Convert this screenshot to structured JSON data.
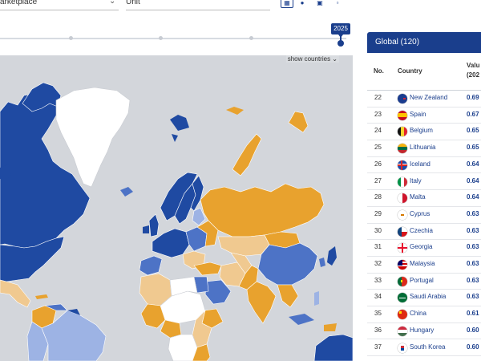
{
  "filters": {
    "marketplace_label": "arketplace",
    "unit_label": "Unit"
  },
  "timeline": {
    "selected_year": "2025"
  },
  "map": {
    "toggle_label": "show countries",
    "colors": {
      "ocean": "#d3d6db",
      "land_nodata": "#ffffff",
      "dark_blue": "#1f4aa2",
      "mid_blue": "#4d73c6",
      "light_blue": "#9db3e4",
      "orange": "#e8a22e",
      "light_orange": "#f0c990"
    }
  },
  "table": {
    "header": "Global (120)",
    "columns": {
      "no": "No.",
      "country": "Country",
      "value": "Valu",
      "value_sub": "(202"
    },
    "rows": [
      {
        "no": "22",
        "country": "New Zealand",
        "value": "0.69",
        "flag": "nz"
      },
      {
        "no": "23",
        "country": "Spain",
        "value": "0.67",
        "flag": "es"
      },
      {
        "no": "24",
        "country": "Belgium",
        "value": "0.65",
        "flag": "be"
      },
      {
        "no": "25",
        "country": "Lithuania",
        "value": "0.65",
        "flag": "lt"
      },
      {
        "no": "26",
        "country": "Iceland",
        "value": "0.64",
        "flag": "is"
      },
      {
        "no": "27",
        "country": "Italy",
        "value": "0.64",
        "flag": "it"
      },
      {
        "no": "28",
        "country": "Malta",
        "value": "0.64",
        "flag": "mt"
      },
      {
        "no": "29",
        "country": "Cyprus",
        "value": "0.63",
        "flag": "cy"
      },
      {
        "no": "30",
        "country": "Czechia",
        "value": "0.63",
        "flag": "cz"
      },
      {
        "no": "31",
        "country": "Georgia",
        "value": "0.63",
        "flag": "ge"
      },
      {
        "no": "32",
        "country": "Malaysia",
        "value": "0.63",
        "flag": "my"
      },
      {
        "no": "33",
        "country": "Portugal",
        "value": "0.63",
        "flag": "pt"
      },
      {
        "no": "34",
        "country": "Saudi Arabia",
        "value": "0.63",
        "flag": "sa"
      },
      {
        "no": "35",
        "country": "China",
        "value": "0.61",
        "flag": "cn"
      },
      {
        "no": "36",
        "country": "Hungary",
        "value": "0.60",
        "flag": "hu"
      },
      {
        "no": "37",
        "country": "South Korea",
        "value": "0.60",
        "flag": "kr"
      }
    ]
  }
}
